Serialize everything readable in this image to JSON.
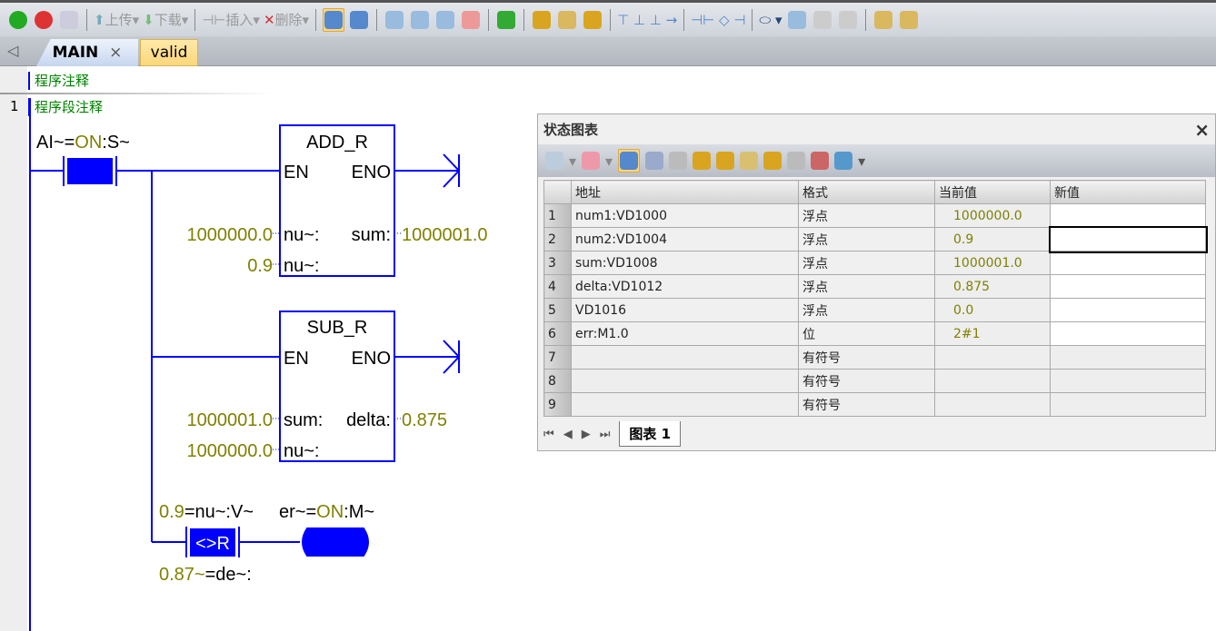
{
  "toolbar": {
    "upload": "上传",
    "download": "下载",
    "insert": "插入",
    "delete": "删除"
  },
  "tabs": [
    {
      "label": "MAIN",
      "close": "×"
    },
    {
      "label": "valid"
    }
  ],
  "editor": {
    "program_comment": "程序注释",
    "network_number": "1",
    "network_comment": "程序段注释"
  },
  "ladder": {
    "contact1_label_pre": "AI~=",
    "contact1_label_on": "ON",
    "contact1_label_post": ":S~",
    "add": {
      "title": "ADD_R",
      "en": "EN",
      "eno": "ENO",
      "in1": "nu~:",
      "in2": "nu~:",
      "out": "sum:",
      "in1_val": "1000000.0",
      "in2_val": "0.9",
      "out_val": "1000001.0"
    },
    "sub": {
      "title": "SUB_R",
      "en": "EN",
      "eno": "ENO",
      "in1": "sum:",
      "in2": "nu~:",
      "out": "delta:",
      "in1_val": "1000001.0",
      "in2_val": "1000000.0",
      "out_val": "0.875"
    },
    "cmp": {
      "top_val": "0.9",
      "top_label": "=nu~:V~",
      "op": "<>R",
      "bot_val": "0.87~",
      "bot_label": "=de~:"
    },
    "coil": {
      "label_pre": "er~=",
      "label_on": "ON",
      "label_post": ":M~"
    }
  },
  "status_chart": {
    "title": "状态图表",
    "close": "×",
    "columns": [
      "地址",
      "格式",
      "当前值",
      "新值"
    ],
    "rows": [
      {
        "n": "1",
        "addr": "num1:VD1000",
        "fmt": "浮点",
        "cur": "1000000.0",
        "new": ""
      },
      {
        "n": "2",
        "addr": "num2:VD1004",
        "fmt": "浮点",
        "cur": "0.9",
        "new": ""
      },
      {
        "n": "3",
        "addr": "sum:VD1008",
        "fmt": "浮点",
        "cur": "1000001.0",
        "new": ""
      },
      {
        "n": "4",
        "addr": "delta:VD1012",
        "fmt": "浮点",
        "cur": "0.875",
        "new": ""
      },
      {
        "n": "5",
        "addr": "VD1016",
        "fmt": "浮点",
        "cur": "0.0",
        "new": ""
      },
      {
        "n": "6",
        "addr": "err:M1.0",
        "fmt": "位",
        "cur": "2#1",
        "new": ""
      },
      {
        "n": "7",
        "addr": "",
        "fmt": "有符号",
        "cur": "",
        "new": ""
      },
      {
        "n": "8",
        "addr": "",
        "fmt": "有符号",
        "cur": "",
        "new": ""
      },
      {
        "n": "9",
        "addr": "",
        "fmt": "有符号",
        "cur": "",
        "new": ""
      }
    ],
    "sheet_tab": "图表 1"
  },
  "colors": {
    "accent": "#0000ff",
    "value": "#808000",
    "comment": "#008000"
  }
}
